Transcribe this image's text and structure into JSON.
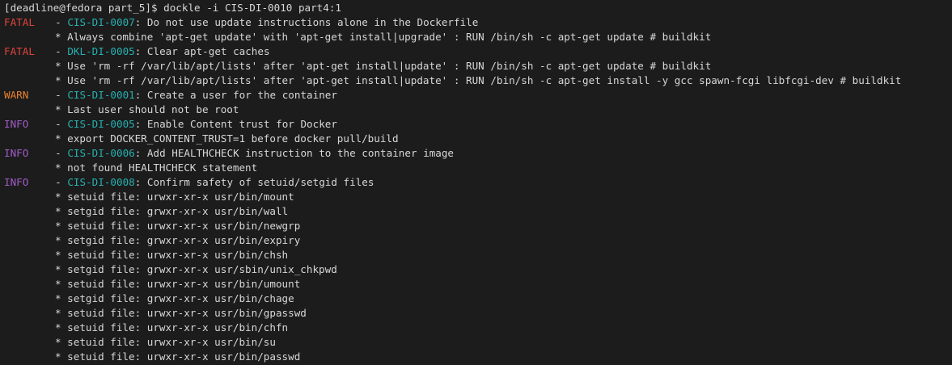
{
  "prompt": "[deadline@fedora part_5]$ dockle -i CIS-DI-0010 part4:1",
  "colors": {
    "background": "#1c1c1c",
    "foreground": "#d7d7d7",
    "fatal": "#e0443e",
    "warn": "#e8822e",
    "info": "#a25cc9",
    "code": "#27b1b1"
  },
  "results": [
    {
      "level": "FATAL",
      "code": "CIS-DI-0007",
      "title": ": Do not use update instructions alone in the Dockerfile",
      "details": [
        "* Always combine 'apt-get update' with 'apt-get install|upgrade' : RUN /bin/sh -c apt-get update # buildkit"
      ]
    },
    {
      "level": "FATAL",
      "code": "DKL-DI-0005",
      "title": ": Clear apt-get caches",
      "details": [
        "* Use 'rm -rf /var/lib/apt/lists' after 'apt-get install|update' : RUN /bin/sh -c apt-get update # buildkit",
        "* Use 'rm -rf /var/lib/apt/lists' after 'apt-get install|update' : RUN /bin/sh -c apt-get install -y gcc spawn-fcgi libfcgi-dev # buildkit"
      ]
    },
    {
      "level": "WARN",
      "code": "CIS-DI-0001",
      "title": ": Create a user for the container",
      "details": [
        "* Last user should not be root"
      ]
    },
    {
      "level": "INFO",
      "code": "CIS-DI-0005",
      "title": ": Enable Content trust for Docker",
      "details": [
        "* export DOCKER_CONTENT_TRUST=1 before docker pull/build"
      ]
    },
    {
      "level": "INFO",
      "code": "CIS-DI-0006",
      "title": ": Add HEALTHCHECK instruction to the container image",
      "details": [
        "* not found HEALTHCHECK statement"
      ]
    },
    {
      "level": "INFO",
      "code": "CIS-DI-0008",
      "title": ": Confirm safety of setuid/setgid files",
      "details": [
        "* setuid file: urwxr-xr-x usr/bin/mount",
        "* setgid file: grwxr-xr-x usr/bin/wall",
        "* setuid file: urwxr-xr-x usr/bin/newgrp",
        "* setgid file: grwxr-xr-x usr/bin/expiry",
        "* setuid file: urwxr-xr-x usr/bin/chsh",
        "* setgid file: grwxr-xr-x usr/sbin/unix_chkpwd",
        "* setuid file: urwxr-xr-x usr/bin/umount",
        "* setgid file: grwxr-xr-x usr/bin/chage",
        "* setuid file: urwxr-xr-x usr/bin/gpasswd",
        "* setuid file: urwxr-xr-x usr/bin/chfn",
        "* setuid file: urwxr-xr-x usr/bin/su",
        "* setuid file: urwxr-xr-x usr/bin/passwd"
      ]
    }
  ]
}
